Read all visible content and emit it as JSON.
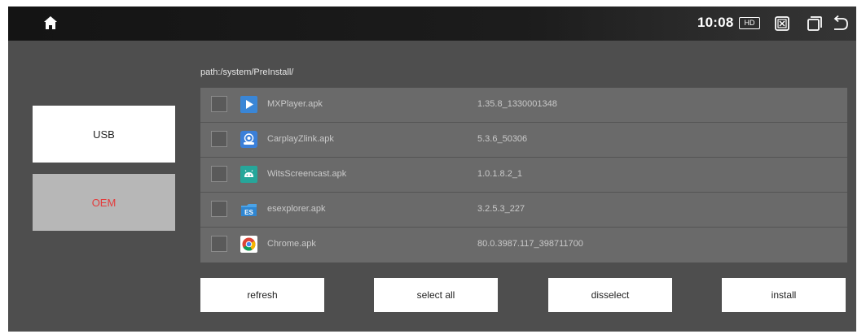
{
  "statusbar": {
    "time": "10:08",
    "hd_badge": "HD",
    "icons": [
      "home-icon",
      "hd-icon",
      "close-box-icon",
      "windows-icon",
      "back-icon"
    ]
  },
  "sidebar": {
    "usb_label": "USB",
    "oem_label": "OEM",
    "selected": "OEM",
    "selected_color": "#e43b3b"
  },
  "path": "path:/system/PreInstall/",
  "files": [
    {
      "name": "MXPlayer.apk",
      "version": "1.35.8_1330001348",
      "icon": "mxplayer-icon",
      "checked": false
    },
    {
      "name": "CarplayZlink.apk",
      "version": "5.3.6_50306",
      "icon": "carplay-zlink-icon",
      "checked": false
    },
    {
      "name": "WitsScreencast.apk",
      "version": "1.0.1.8.2_1",
      "icon": "android-icon",
      "checked": false
    },
    {
      "name": "esexplorer.apk",
      "version": "3.2.5.3_227",
      "icon": "es-explorer-icon",
      "checked": false
    },
    {
      "name": "Chrome.apk",
      "version": "80.0.3987.117_398711700",
      "icon": "chrome-icon",
      "checked": false
    }
  ],
  "actions": {
    "refresh": "refresh",
    "select_all": "select all",
    "disselect": "disselect",
    "install": "install"
  }
}
